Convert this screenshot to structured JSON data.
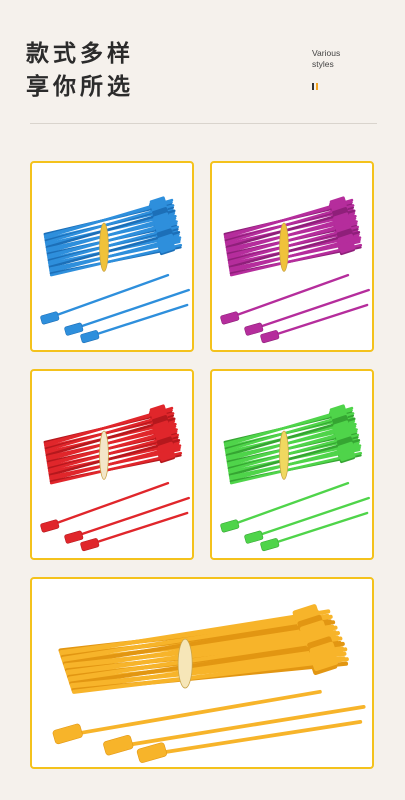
{
  "heading": {
    "line1": "款式多样",
    "line2": "享你所选"
  },
  "side_label": {
    "line1": "Various",
    "line2": "styles"
  },
  "colors": {
    "background": "#f5f1ec",
    "card_border": "#f4c21c",
    "blue": "#2e8fdc",
    "magenta": "#b52d9c",
    "red": "#e0262b",
    "green": "#4fd44a",
    "yellow": "#f7b42a"
  },
  "products": [
    {
      "name": "blue-skewer-bundle",
      "color": "#2e8fdc",
      "dark": "#1c6fb8",
      "tie": "#f0c23a"
    },
    {
      "name": "magenta-skewer-bundle",
      "color": "#b52d9c",
      "dark": "#8f1f7a",
      "tie": "#f0c23a"
    },
    {
      "name": "red-skewer-bundle",
      "color": "#e0262b",
      "dark": "#b5181d",
      "tie": "#f3e6c9"
    },
    {
      "name": "green-skewer-bundle",
      "color": "#4fd44a",
      "dark": "#35a532",
      "tie": "#f0d860"
    },
    {
      "name": "yellow-skewer-bundle",
      "color": "#f7b42a",
      "dark": "#e29612",
      "tie": "#f6e6b8"
    }
  ]
}
